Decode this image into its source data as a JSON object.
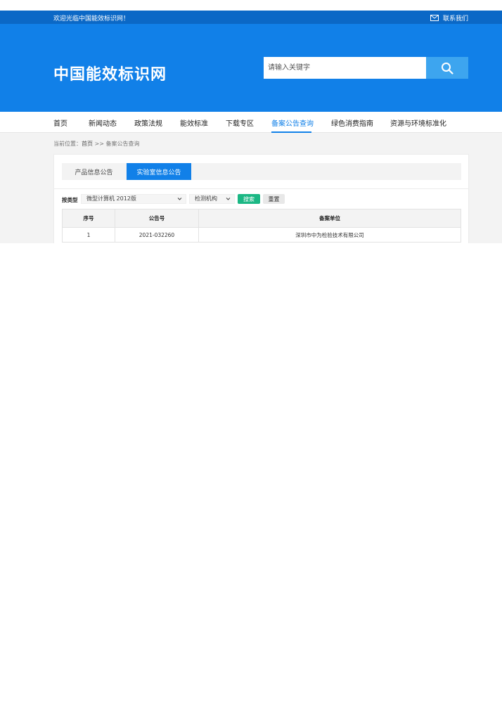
{
  "top_bar": {
    "welcome": "欢迎光临中国能效标识网！",
    "contact_icon": "mail-icon",
    "contact_label": "联系我们"
  },
  "header": {
    "logo": "中国能效标识网",
    "search_placeholder": "请输入关键字",
    "search_icon": "search-icon"
  },
  "nav": {
    "items": [
      {
        "label": "首页"
      },
      {
        "label": "新闻动态"
      },
      {
        "label": "政策法规"
      },
      {
        "label": "能效标准"
      },
      {
        "label": "下载专区"
      },
      {
        "label": "备案公告查询",
        "active": true
      },
      {
        "label": "绿色消费指南"
      },
      {
        "label": "资源与环境标准化"
      }
    ]
  },
  "breadcrumb": {
    "prefix": "当前位置：",
    "home": "首页",
    "separator": " >> ",
    "current": "备案公告查询"
  },
  "tabs": [
    {
      "label": "产品信息公告",
      "active": false
    },
    {
      "label": "实验室信息公告",
      "active": true
    }
  ],
  "filters": {
    "label": "按类型",
    "type_value": "微型计算机 2012版",
    "org_value": "检测机构",
    "search_label": "搜索",
    "reset_label": "重置"
  },
  "table": {
    "headers": [
      "序号",
      "公告号",
      "备案单位"
    ],
    "rows": [
      [
        "1",
        "2021-032260",
        "深圳市中为检验技术有限公司"
      ]
    ]
  },
  "colors": {
    "header_blue": "#1180e8",
    "top_strip": "#0b68c6",
    "search_button": "#3da5ef",
    "search_green": "#1bb784"
  }
}
